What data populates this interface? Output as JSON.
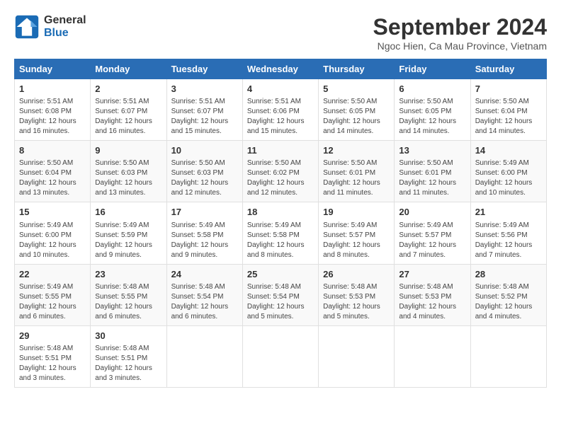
{
  "logo": {
    "line1": "General",
    "line2": "Blue"
  },
  "title": "September 2024",
  "location": "Ngoc Hien, Ca Mau Province, Vietnam",
  "days_header": [
    "Sunday",
    "Monday",
    "Tuesday",
    "Wednesday",
    "Thursday",
    "Friday",
    "Saturday"
  ],
  "weeks": [
    [
      {
        "day": "1",
        "info": "Sunrise: 5:51 AM\nSunset: 6:08 PM\nDaylight: 12 hours\nand 16 minutes."
      },
      {
        "day": "2",
        "info": "Sunrise: 5:51 AM\nSunset: 6:07 PM\nDaylight: 12 hours\nand 16 minutes."
      },
      {
        "day": "3",
        "info": "Sunrise: 5:51 AM\nSunset: 6:07 PM\nDaylight: 12 hours\nand 15 minutes."
      },
      {
        "day": "4",
        "info": "Sunrise: 5:51 AM\nSunset: 6:06 PM\nDaylight: 12 hours\nand 15 minutes."
      },
      {
        "day": "5",
        "info": "Sunrise: 5:50 AM\nSunset: 6:05 PM\nDaylight: 12 hours\nand 14 minutes."
      },
      {
        "day": "6",
        "info": "Sunrise: 5:50 AM\nSunset: 6:05 PM\nDaylight: 12 hours\nand 14 minutes."
      },
      {
        "day": "7",
        "info": "Sunrise: 5:50 AM\nSunset: 6:04 PM\nDaylight: 12 hours\nand 14 minutes."
      }
    ],
    [
      {
        "day": "8",
        "info": "Sunrise: 5:50 AM\nSunset: 6:04 PM\nDaylight: 12 hours\nand 13 minutes."
      },
      {
        "day": "9",
        "info": "Sunrise: 5:50 AM\nSunset: 6:03 PM\nDaylight: 12 hours\nand 13 minutes."
      },
      {
        "day": "10",
        "info": "Sunrise: 5:50 AM\nSunset: 6:03 PM\nDaylight: 12 hours\nand 12 minutes."
      },
      {
        "day": "11",
        "info": "Sunrise: 5:50 AM\nSunset: 6:02 PM\nDaylight: 12 hours\nand 12 minutes."
      },
      {
        "day": "12",
        "info": "Sunrise: 5:50 AM\nSunset: 6:01 PM\nDaylight: 12 hours\nand 11 minutes."
      },
      {
        "day": "13",
        "info": "Sunrise: 5:50 AM\nSunset: 6:01 PM\nDaylight: 12 hours\nand 11 minutes."
      },
      {
        "day": "14",
        "info": "Sunrise: 5:49 AM\nSunset: 6:00 PM\nDaylight: 12 hours\nand 10 minutes."
      }
    ],
    [
      {
        "day": "15",
        "info": "Sunrise: 5:49 AM\nSunset: 6:00 PM\nDaylight: 12 hours\nand 10 minutes."
      },
      {
        "day": "16",
        "info": "Sunrise: 5:49 AM\nSunset: 5:59 PM\nDaylight: 12 hours\nand 9 minutes."
      },
      {
        "day": "17",
        "info": "Sunrise: 5:49 AM\nSunset: 5:58 PM\nDaylight: 12 hours\nand 9 minutes."
      },
      {
        "day": "18",
        "info": "Sunrise: 5:49 AM\nSunset: 5:58 PM\nDaylight: 12 hours\nand 8 minutes."
      },
      {
        "day": "19",
        "info": "Sunrise: 5:49 AM\nSunset: 5:57 PM\nDaylight: 12 hours\nand 8 minutes."
      },
      {
        "day": "20",
        "info": "Sunrise: 5:49 AM\nSunset: 5:57 PM\nDaylight: 12 hours\nand 7 minutes."
      },
      {
        "day": "21",
        "info": "Sunrise: 5:49 AM\nSunset: 5:56 PM\nDaylight: 12 hours\nand 7 minutes."
      }
    ],
    [
      {
        "day": "22",
        "info": "Sunrise: 5:49 AM\nSunset: 5:55 PM\nDaylight: 12 hours\nand 6 minutes."
      },
      {
        "day": "23",
        "info": "Sunrise: 5:48 AM\nSunset: 5:55 PM\nDaylight: 12 hours\nand 6 minutes."
      },
      {
        "day": "24",
        "info": "Sunrise: 5:48 AM\nSunset: 5:54 PM\nDaylight: 12 hours\nand 6 minutes."
      },
      {
        "day": "25",
        "info": "Sunrise: 5:48 AM\nSunset: 5:54 PM\nDaylight: 12 hours\nand 5 minutes."
      },
      {
        "day": "26",
        "info": "Sunrise: 5:48 AM\nSunset: 5:53 PM\nDaylight: 12 hours\nand 5 minutes."
      },
      {
        "day": "27",
        "info": "Sunrise: 5:48 AM\nSunset: 5:53 PM\nDaylight: 12 hours\nand 4 minutes."
      },
      {
        "day": "28",
        "info": "Sunrise: 5:48 AM\nSunset: 5:52 PM\nDaylight: 12 hours\nand 4 minutes."
      }
    ],
    [
      {
        "day": "29",
        "info": "Sunrise: 5:48 AM\nSunset: 5:51 PM\nDaylight: 12 hours\nand 3 minutes."
      },
      {
        "day": "30",
        "info": "Sunrise: 5:48 AM\nSunset: 5:51 PM\nDaylight: 12 hours\nand 3 minutes."
      },
      {
        "day": "",
        "info": ""
      },
      {
        "day": "",
        "info": ""
      },
      {
        "day": "",
        "info": ""
      },
      {
        "day": "",
        "info": ""
      },
      {
        "day": "",
        "info": ""
      }
    ]
  ]
}
